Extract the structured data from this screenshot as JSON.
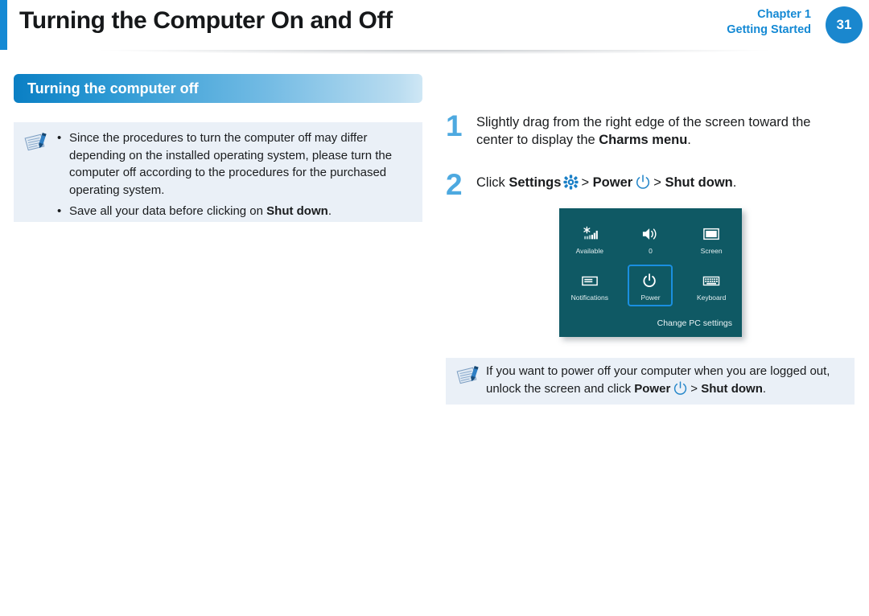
{
  "header": {
    "title": "Turning the Computer On and Off",
    "chapter": "Chapter 1",
    "chapter_subtitle": "Getting Started",
    "page_number": "31",
    "accent_color": "#1489d4",
    "page_circle_color": "#1a87ce"
  },
  "section": {
    "title": "Turning the computer off",
    "gradient_from": "#0a7fc4",
    "gradient_to": "#cfe7f5"
  },
  "note_left": {
    "icon": "note-pen-icon",
    "bullet": "•",
    "items": [
      {
        "text_before": "Since the procedures to turn the computer off may differ depending on the installed operating system, please turn the computer off according to the procedures for the purchased operating system.",
        "bold": "",
        "text_after": ""
      },
      {
        "text_before": "Save all your data before clicking on ",
        "bold": "Shut down",
        "text_after": "."
      }
    ]
  },
  "steps": [
    {
      "number": "1",
      "text_before": "Slightly drag from the right edge of the screen toward the center to display the ",
      "bold": "Charms menu",
      "text_after": "."
    },
    {
      "number": "2",
      "prefix": "Click ",
      "bold_settings": "Settings",
      "settings_icon": "gear-icon",
      "separator_1": "> ",
      "bold_power": "Power",
      "power_icon": "power-icon",
      "separator_2": "> ",
      "bold_shutdown": "Shut down",
      "suffix": "."
    }
  ],
  "charms_panel": {
    "background_color": "#0f5964",
    "highlight_color": "#1a8fe0",
    "tiles": [
      {
        "icon": "wifi-icon",
        "label": "Available"
      },
      {
        "icon": "volume-icon",
        "label": "0"
      },
      {
        "icon": "screen-icon",
        "label": "Screen"
      },
      {
        "icon": "notifications-icon",
        "label": "Notifications"
      },
      {
        "icon": "power-icon",
        "label": "Power"
      },
      {
        "icon": "keyboard-icon",
        "label": "Keyboard"
      }
    ],
    "highlighted_tile": "Power",
    "settings_link": "Change PC settings"
  },
  "note_right": {
    "icon": "note-pen-icon",
    "text_before": "If you want to power off your computer when you are logged out, unlock the screen and click ",
    "bold_power": "Power",
    "power_icon": "power-icon",
    "separator": "> ",
    "bold_shutdown": "Shut down",
    "text_after": "."
  }
}
